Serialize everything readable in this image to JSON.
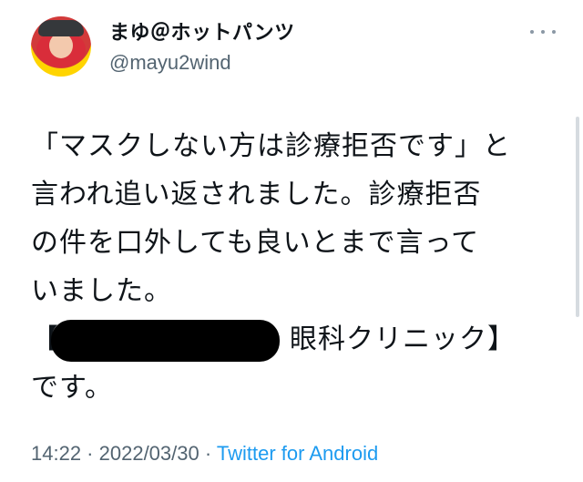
{
  "tweet": {
    "author": {
      "display_name": "まゆ＠ホットパンツ",
      "handle": "@mayu2wind"
    },
    "text_lines": [
      "「マスクしない方は診療拒否です」と",
      "言われ追い返されました。診療拒否",
      "の件を口外しても良いとまで言って",
      "いました。",
      "【",
      "眼科クリニック】",
      "です。"
    ],
    "meta": {
      "time": "14:22",
      "separator_1": " · ",
      "date": "2022/03/30",
      "separator_2": " · ",
      "source": "Twitter for Android"
    },
    "icons": {
      "avatar": "profile-photo",
      "more": "more-icon",
      "redaction": "black-redaction"
    }
  }
}
